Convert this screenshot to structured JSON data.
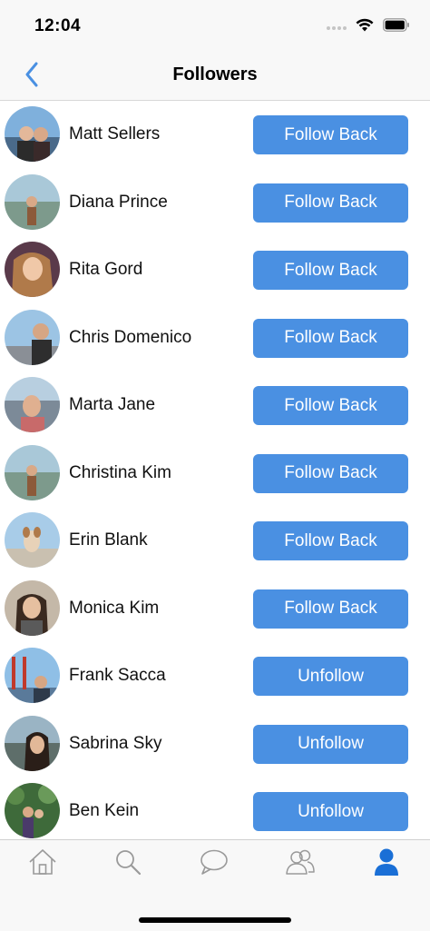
{
  "status_bar": {
    "time": "12:04",
    "icons": [
      "signal-icon",
      "wifi-icon",
      "battery-icon"
    ]
  },
  "nav": {
    "title": "Followers",
    "back_icon": "chevron-left-icon"
  },
  "colors": {
    "accent": "#4a90e2",
    "button_text": "#ffffff",
    "bar_background": "#f8f8f8",
    "tab_inactive": "#9a9a9a",
    "tab_active": "#1a6fd6"
  },
  "followers": [
    {
      "name": "Matt Sellers",
      "action": "Follow Back"
    },
    {
      "name": "Diana Prince",
      "action": "Follow Back"
    },
    {
      "name": "Rita Gord",
      "action": "Follow Back"
    },
    {
      "name": "Chris Domenico",
      "action": "Follow Back"
    },
    {
      "name": "Marta Jane",
      "action": "Follow Back"
    },
    {
      "name": "Christina Kim",
      "action": "Follow Back"
    },
    {
      "name": "Erin Blank",
      "action": "Follow Back"
    },
    {
      "name": "Monica Kim",
      "action": "Follow Back"
    },
    {
      "name": "Frank Sacca",
      "action": "Unfollow"
    },
    {
      "name": "Sabrina Sky",
      "action": "Unfollow"
    },
    {
      "name": "Ben Kein",
      "action": "Unfollow"
    }
  ],
  "tabs": [
    {
      "icon": "home-icon",
      "active": false
    },
    {
      "icon": "search-icon",
      "active": false
    },
    {
      "icon": "chat-icon",
      "active": false
    },
    {
      "icon": "people-icon",
      "active": false
    },
    {
      "icon": "profile-icon",
      "active": true
    }
  ]
}
